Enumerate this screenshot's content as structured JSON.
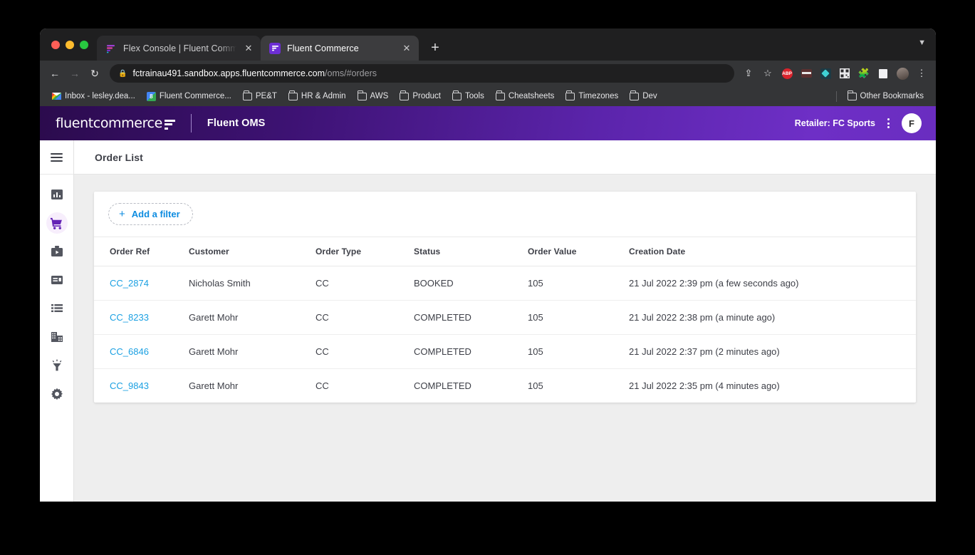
{
  "browser": {
    "tabs": [
      {
        "title": "Flex Console | Fluent Commerce",
        "favicon": "flex-console-icon",
        "active": false
      },
      {
        "title": "Fluent Commerce",
        "favicon": "fluent-commerce-icon",
        "active": true
      }
    ],
    "new_tab_label": "+",
    "tabstrip_chevron": "⌄",
    "nav": {
      "back": "←",
      "forward": "→",
      "reload": "↻"
    },
    "omnibox": {
      "lock_icon": "lock-icon",
      "host": "fctrainau491.sandbox.apps.fluentcommerce.com",
      "path": "/oms/#orders"
    },
    "toolbar_icons": [
      "share-icon",
      "bookmark-star-icon",
      "adblock-plus-icon",
      "extension-van-icon",
      "extension-teal-icon",
      "qr-code-icon",
      "extensions-puzzle-icon",
      "reading-list-icon",
      "profile-avatar-icon",
      "chrome-menu-icon"
    ],
    "bookmarks": [
      {
        "label": "Inbox - lesley.dea...",
        "icon": "gmail-icon"
      },
      {
        "label": "Fluent Commerce...",
        "icon": "fluent-commerce-bookmark-icon"
      },
      {
        "label": "PE&T",
        "icon": "folder-icon"
      },
      {
        "label": "HR & Admin",
        "icon": "folder-icon"
      },
      {
        "label": "AWS",
        "icon": "folder-icon"
      },
      {
        "label": "Product",
        "icon": "folder-icon"
      },
      {
        "label": "Tools",
        "icon": "folder-icon"
      },
      {
        "label": "Cheatsheets",
        "icon": "folder-icon"
      },
      {
        "label": "Timezones",
        "icon": "folder-icon"
      },
      {
        "label": "Dev",
        "icon": "folder-icon"
      }
    ],
    "other_bookmarks": {
      "label": "Other Bookmarks",
      "icon": "folder-icon"
    }
  },
  "app": {
    "brand": {
      "logo_text": "fluentcommerce",
      "app_name": "Fluent OMS"
    },
    "header": {
      "retailer_label": "Retailer: FC Sports",
      "kebab_icon": "kebab-menu-icon",
      "avatar_initial": "F"
    },
    "sidebar": {
      "menu_toggle_icon": "hamburger-menu-icon",
      "items": [
        {
          "name": "dashboard",
          "icon": "bar-chart-icon",
          "active": false
        },
        {
          "name": "orders",
          "icon": "shopping-cart-icon",
          "active": true
        },
        {
          "name": "fulfilments",
          "icon": "briefcase-play-icon",
          "active": false
        },
        {
          "name": "inventory",
          "icon": "card-panel-icon",
          "active": false
        },
        {
          "name": "catalogue",
          "icon": "list-icon",
          "active": false
        },
        {
          "name": "locations",
          "icon": "building-icon",
          "active": false
        },
        {
          "name": "insights",
          "icon": "funnel-lamp-icon",
          "active": false
        },
        {
          "name": "settings",
          "icon": "gear-icon",
          "active": false
        }
      ]
    },
    "page": {
      "title": "Order List"
    },
    "filter": {
      "label": "Add a filter",
      "plus_icon": "plus-icon"
    },
    "table": {
      "columns": [
        "Order Ref",
        "Customer",
        "Order Type",
        "Status",
        "Order Value",
        "Creation Date"
      ],
      "rows": [
        {
          "order_ref": "CC_2874",
          "customer": "Nicholas Smith",
          "order_type": "CC",
          "status": "BOOKED",
          "order_value": "105",
          "creation_date": "21 Jul 2022 2:39 pm (a few seconds ago)"
        },
        {
          "order_ref": "CC_8233",
          "customer": "Garett Mohr",
          "order_type": "CC",
          "status": "COMPLETED",
          "order_value": "105",
          "creation_date": "21 Jul 2022 2:38 pm (a minute ago)"
        },
        {
          "order_ref": "CC_6846",
          "customer": "Garett Mohr",
          "order_type": "CC",
          "status": "COMPLETED",
          "order_value": "105",
          "creation_date": "21 Jul 2022 2:37 pm (2 minutes ago)"
        },
        {
          "order_ref": "CC_9843",
          "customer": "Garett Mohr",
          "order_type": "CC",
          "status": "COMPLETED",
          "order_value": "105",
          "creation_date": "21 Jul 2022 2:35 pm (4 minutes ago)"
        }
      ]
    }
  },
  "colors": {
    "brand_purple": "#6a2dc0",
    "brand_purple_dark": "#2b0b4d",
    "link_blue": "#1ba0e2",
    "filter_blue": "#0d8ce0",
    "page_bg": "#eeeeee"
  }
}
